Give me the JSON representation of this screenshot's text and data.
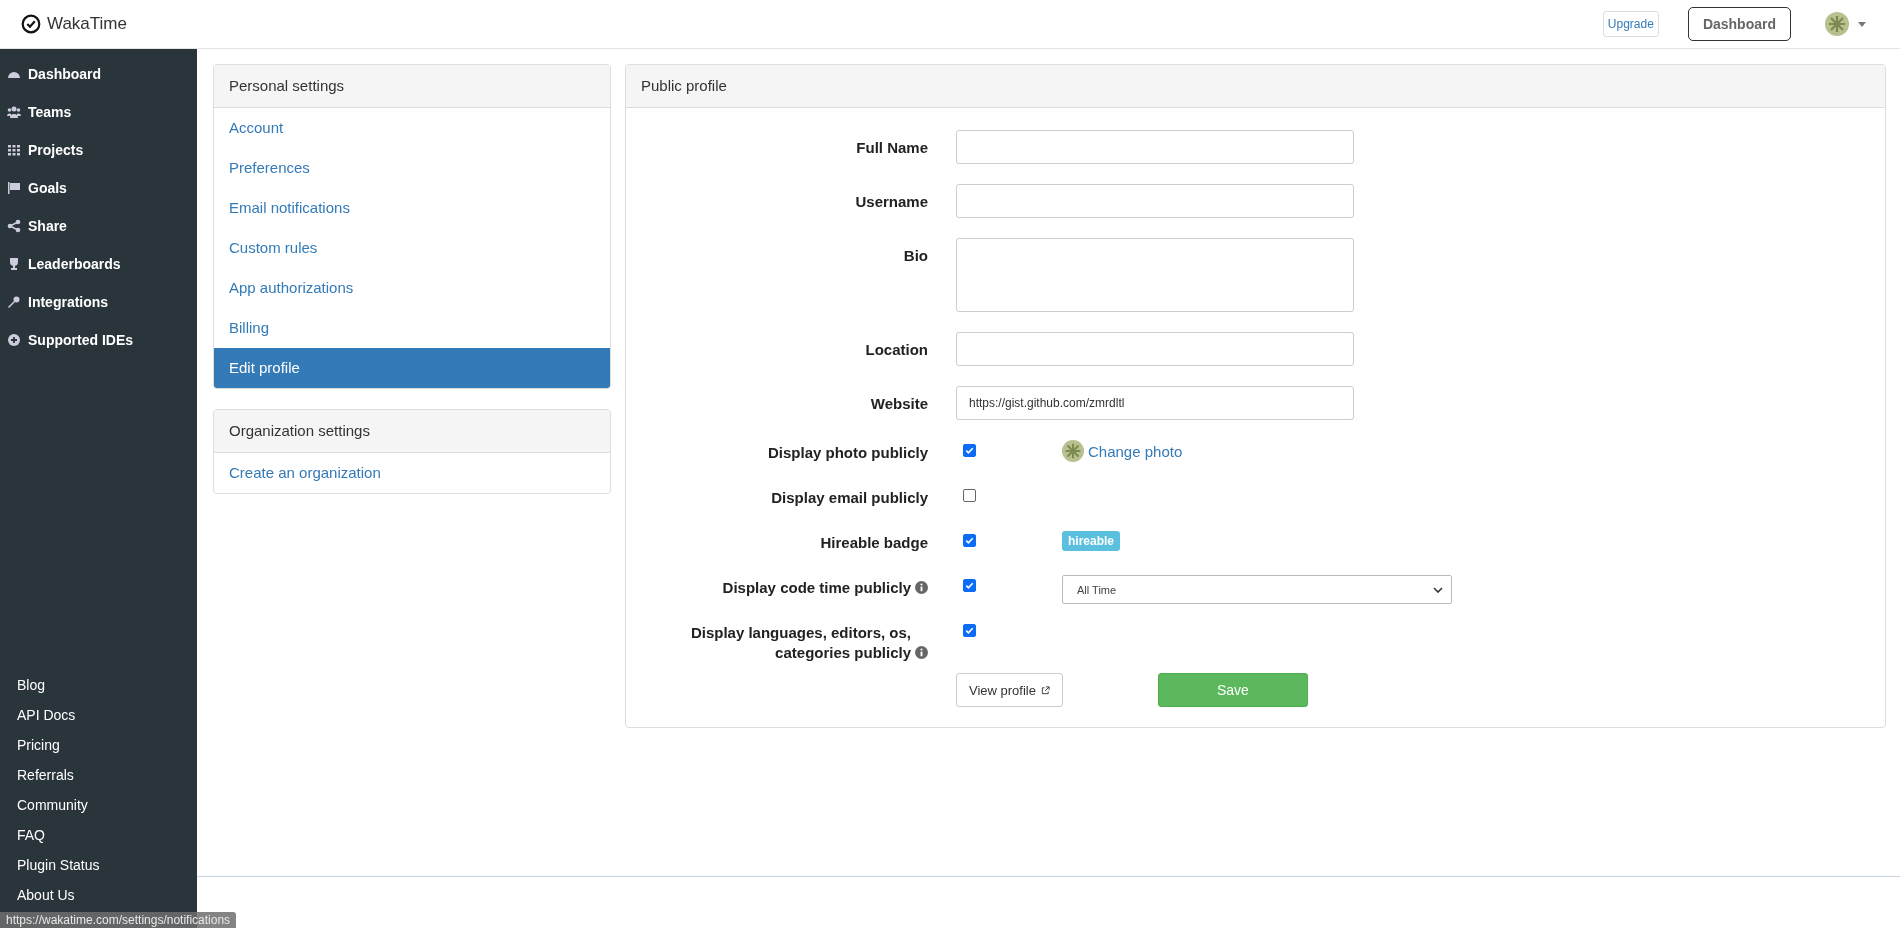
{
  "brand": {
    "name": "WakaTime"
  },
  "top_nav": {
    "upgrade": "Upgrade",
    "dashboard": "Dashboard"
  },
  "sidebar": {
    "items": [
      {
        "label": "Dashboard"
      },
      {
        "label": "Teams"
      },
      {
        "label": "Projects"
      },
      {
        "label": "Goals"
      },
      {
        "label": "Share"
      },
      {
        "label": "Leaderboards"
      },
      {
        "label": "Integrations"
      },
      {
        "label": "Supported IDEs"
      }
    ],
    "links": [
      "Blog",
      "API Docs",
      "Pricing",
      "Referrals",
      "Community",
      "FAQ",
      "Plugin Status",
      "About Us"
    ]
  },
  "settings_menu": {
    "title": "Personal settings",
    "items": [
      {
        "label": "Account",
        "selected": false
      },
      {
        "label": "Preferences",
        "selected": false
      },
      {
        "label": "Email notifications",
        "selected": false
      },
      {
        "label": "Custom rules",
        "selected": false
      },
      {
        "label": "App authorizations",
        "selected": false
      },
      {
        "label": "Billing",
        "selected": false
      },
      {
        "label": "Edit profile",
        "selected": true
      }
    ]
  },
  "organization_menu": {
    "title": "Organization settings",
    "items": [
      {
        "label": "Create an organization",
        "selected": false
      }
    ]
  },
  "profile_form": {
    "title": "Public profile",
    "fields": [
      {
        "label": "Full Name",
        "kind": "text"
      },
      {
        "label": "Username",
        "kind": "text"
      },
      {
        "label": "Bio",
        "kind": "textarea"
      },
      {
        "label": "Location",
        "kind": "text"
      },
      {
        "label": "Website",
        "kind": "text",
        "value": "https://gist.github.com/zmrdltl"
      }
    ],
    "options": [
      {
        "label": "Display photo publicly",
        "checked": true,
        "info": false,
        "extra": {
          "kind": "photo-link",
          "text": "Change photo"
        }
      },
      {
        "label": "Display email publicly",
        "checked": false,
        "info": false
      },
      {
        "label": "Hireable badge",
        "checked": true,
        "info": false,
        "extra": {
          "kind": "badge",
          "text": "hireable"
        }
      },
      {
        "label": "Display code time publicly",
        "checked": true,
        "info": true,
        "extra": {
          "kind": "select",
          "text": "All Time"
        }
      },
      {
        "label": "Display languages, editors, os, categories publicly",
        "checked": true,
        "info": true
      }
    ],
    "view_button": "View profile",
    "save_button": "Save"
  },
  "status_bar": {
    "url": "https://wakatime.com/settings/notifications"
  }
}
